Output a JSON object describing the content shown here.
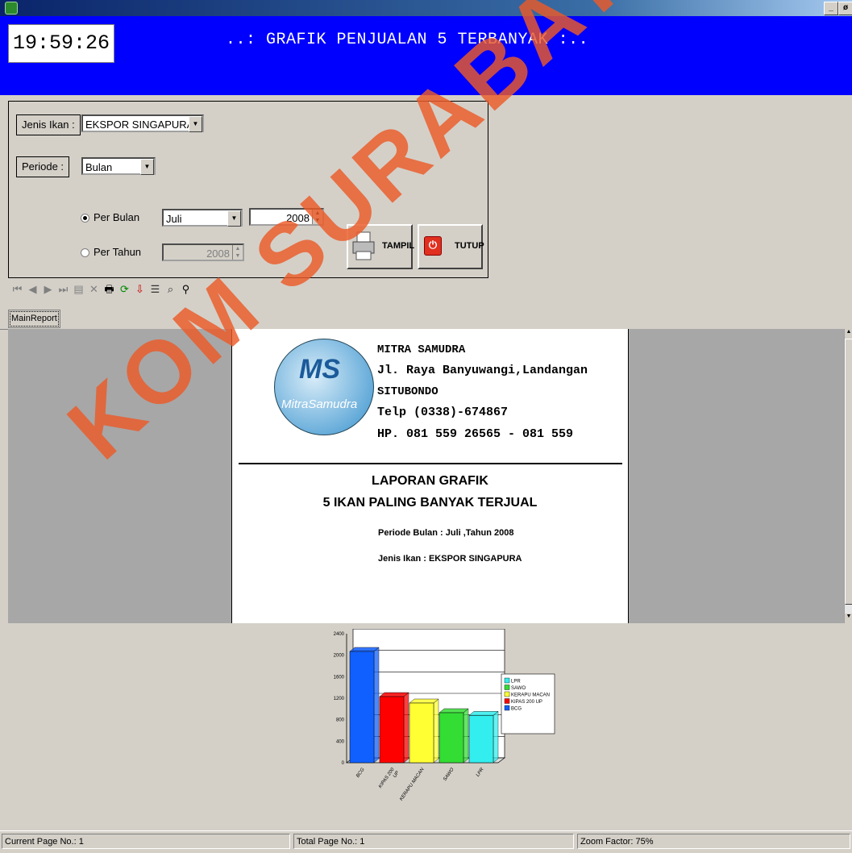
{
  "window": {
    "minimize": "_",
    "restore": "ø",
    "close": "×"
  },
  "header": {
    "clock": "19:59:26",
    "title": "..: GRAFIK PENJUALAN 5 TERBANYAK :.."
  },
  "filters": {
    "jenis_label": "Jenis Ikan  :",
    "jenis_value": "EKSPOR SINGAPURA",
    "periode_label": "Periode   :",
    "periode_value": "Bulan",
    "per_bulan_label": "Per Bulan",
    "per_tahun_label": "Per Tahun",
    "month_value": "Juli",
    "year_value": "2008",
    "year_disabled_value": "2008",
    "tampil_label": "TAMPIL",
    "tutup_label": "TUTUP"
  },
  "viewer": {
    "tab_label": "MainReport"
  },
  "report": {
    "company": "MITRA SAMUDRA",
    "address": "Jl. Raya Banyuwangi,Landangan",
    "city": "SITUBONDO",
    "phone": "Telp (0338)-674867",
    "hp": "HP. 081 559 26565 - 081 559",
    "logo_text_1": "MS",
    "logo_text_2": "MitraSamudra",
    "title_1": "LAPORAN GRAFIK",
    "title_2": "5 IKAN PALING BANYAK TERJUAL",
    "periode_line": "Periode Bulan : Juli ,Tahun 2008",
    "jenis_line": "Jenis Ikan : EKSPOR SINGAPURA"
  },
  "chart_data": {
    "type": "bar",
    "categories": [
      "BCG",
      "KIPAS 200 UP",
      "KERAPU MACAN",
      "SAWO",
      "LPR"
    ],
    "values": [
      2070,
      1230,
      1110,
      930,
      880
    ],
    "colors": [
      "#1060ff",
      "#ff0000",
      "#ffff33",
      "#33dd33",
      "#33eeee"
    ],
    "yticks": [
      0,
      400,
      800,
      1200,
      1600,
      2000,
      2400
    ],
    "ylim": [
      0,
      2400
    ],
    "legend": [
      {
        "name": "LPR",
        "color": "#33eeee"
      },
      {
        "name": "SAWO",
        "color": "#33dd33"
      },
      {
        "name": "KERAPU MACAN",
        "color": "#ffff33"
      },
      {
        "name": "KIPAS 200 UP",
        "color": "#ff0000"
      },
      {
        "name": "BCG",
        "color": "#1060ff"
      }
    ],
    "legend_position": "right",
    "grid": true
  },
  "status": {
    "current_page": "Current Page No.: 1",
    "total_page": "Total Page No.: 1",
    "zoom": "Zoom Factor: 75%"
  },
  "watermark": "KOM SURABAYA"
}
